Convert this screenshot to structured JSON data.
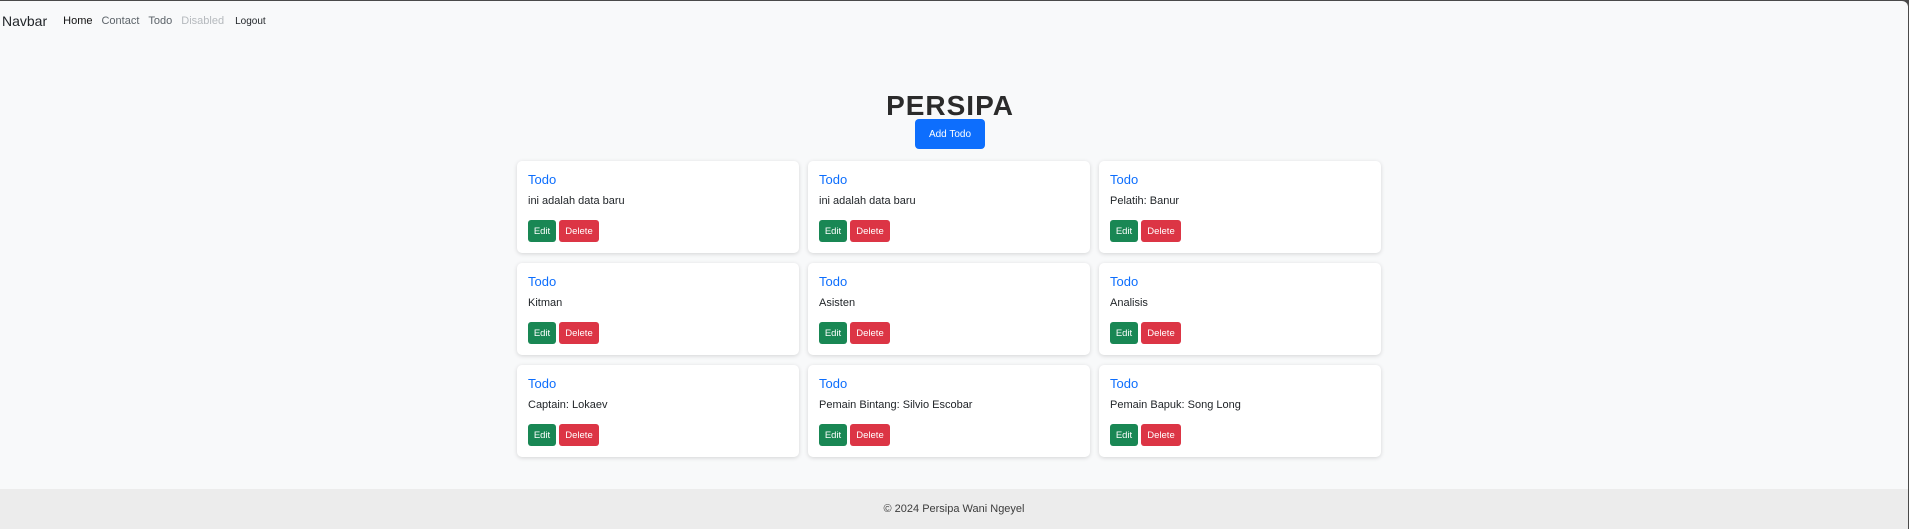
{
  "navbar": {
    "brand": "Navbar",
    "links": [
      {
        "label": "Home"
      },
      {
        "label": "Contact"
      },
      {
        "label": "Todo"
      },
      {
        "label": "Disabled"
      }
    ],
    "logout_label": "Logout"
  },
  "page": {
    "title": "PERSIPA",
    "add_button_label": "Add Todo"
  },
  "todos": [
    {
      "title": "Todo",
      "text": "ini adalah data baru",
      "edit_label": "Edit",
      "delete_label": "Delete"
    },
    {
      "title": "Todo",
      "text": "ini adalah data baru",
      "edit_label": "Edit",
      "delete_label": "Delete"
    },
    {
      "title": "Todo",
      "text": "Pelatih: Banur",
      "edit_label": "Edit",
      "delete_label": "Delete"
    },
    {
      "title": "Todo",
      "text": "Kitman",
      "edit_label": "Edit",
      "delete_label": "Delete"
    },
    {
      "title": "Todo",
      "text": "Asisten",
      "edit_label": "Edit",
      "delete_label": "Delete"
    },
    {
      "title": "Todo",
      "text": "Analisis",
      "edit_label": "Edit",
      "delete_label": "Delete"
    },
    {
      "title": "Todo",
      "text": "Captain: Lokaev",
      "edit_label": "Edit",
      "delete_label": "Delete"
    },
    {
      "title": "Todo",
      "text": "Pemain Bintang: Silvio Escobar",
      "edit_label": "Edit",
      "delete_label": "Delete"
    },
    {
      "title": "Todo",
      "text": "Pemain Bapuk: Song Long",
      "edit_label": "Edit",
      "delete_label": "Delete"
    }
  ],
  "footer": {
    "text": "© 2024 Persipa Wani Ngeyel"
  },
  "colors": {
    "primary": "#0d6efd",
    "success": "#198754",
    "danger": "#dc3545",
    "background": "#f8f9fa"
  }
}
